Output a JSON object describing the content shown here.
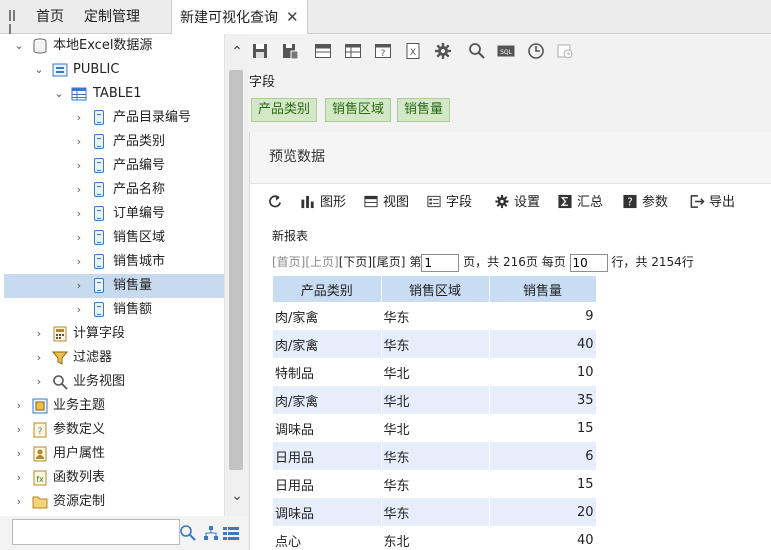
{
  "tabs": [
    {
      "label": "首页"
    },
    {
      "label": "定制管理"
    },
    {
      "label": "新建可视化查询",
      "close": "✕"
    }
  ],
  "tree": {
    "root": "本地Excel数据源",
    "schema": "PUBLIC",
    "table": "TABLE1",
    "fields": [
      "产品目录编号",
      "产品类别",
      "产品编号",
      "产品名称",
      "订单编号",
      "销售区域",
      "销售城市",
      "销售量",
      "销售额"
    ],
    "selected_field": "销售量",
    "subnodes": [
      "计算字段",
      "过滤器",
      "业务视图"
    ],
    "top_nodes": [
      "业务主题",
      "参数定义",
      "用户属性",
      "函数列表",
      "资源定制"
    ]
  },
  "field_section": {
    "label": "字段",
    "chips": [
      "产品类别",
      "销售区域",
      "销售量"
    ]
  },
  "preview": {
    "title": "预览数据",
    "toolbar": [
      "图形",
      "视图",
      "字段",
      "设置",
      "汇总",
      "参数",
      "导出"
    ],
    "report_name": "新报表",
    "pager": {
      "first": "[首页]",
      "prev": "[上页]",
      "next": "[下页]",
      "last": "[尾页]",
      "page_prefix": "第",
      "page_value": "1",
      "page_suffix": "页，共 216页 每页",
      "per_page_value": "10",
      "rows_suffix": "行，共 2154行"
    },
    "columns": [
      "产品类别",
      "销售区域",
      "销售量"
    ],
    "rows": [
      [
        "肉/家禽",
        "华东",
        "9"
      ],
      [
        "肉/家禽",
        "华东",
        "40"
      ],
      [
        "特制品",
        "华北",
        "10"
      ],
      [
        "肉/家禽",
        "华北",
        "35"
      ],
      [
        "调味品",
        "华北",
        "15"
      ],
      [
        "日用品",
        "华东",
        "6"
      ],
      [
        "日用品",
        "华东",
        "15"
      ],
      [
        "调味品",
        "华东",
        "20"
      ],
      [
        "点心",
        "东北",
        "40"
      ]
    ]
  },
  "colors": {
    "chip_bg": "#d3e8c6",
    "chip_text": "#2a6a14",
    "header_bg": "#c8dcf2",
    "row_alt_bg": "#e6eefb",
    "selected_bg": "#c8dbee"
  }
}
